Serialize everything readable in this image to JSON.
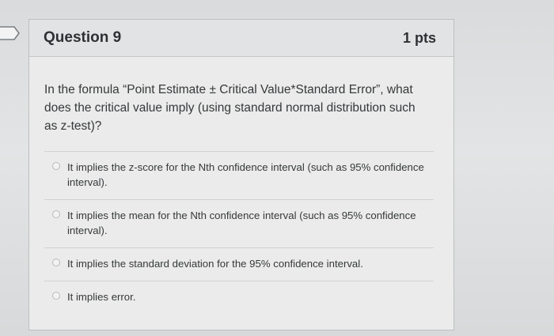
{
  "question": {
    "title": "Question 9",
    "points": "1 pts",
    "text": "In the formula “Point Estimate ± Critical Value*Standard Error”, what does the critical value imply (using standard normal distribution such as z-test)?"
  },
  "answers": [
    {
      "label": "It implies the z-score for the Nth confidence interval (such as 95% confidence interval).",
      "selected": false
    },
    {
      "label": "It implies the mean for the Nth confidence interval (such as 95% confidence interval).",
      "selected": false
    },
    {
      "label": "It implies the standard deviation for the 95% confidence interval.",
      "selected": false
    },
    {
      "label": "It implies error.",
      "selected": false
    }
  ],
  "icons": {
    "bookmark": "bookmark-icon"
  }
}
